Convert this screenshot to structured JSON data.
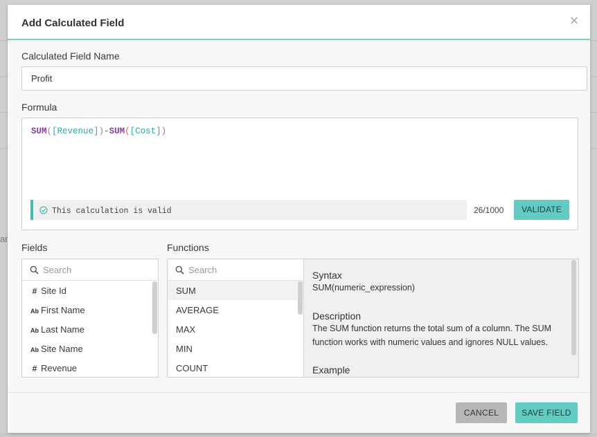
{
  "background": {
    "left_fragment": "ar"
  },
  "modal": {
    "title": "Add Calculated Field",
    "close_icon": "close-icon",
    "accent_color": "#62ccc2"
  },
  "name_field": {
    "label": "Calculated Field Name",
    "value": "Profit"
  },
  "formula": {
    "label": "Formula",
    "tokens": {
      "fn1": "SUM",
      "open1": "(",
      "field1": "[Revenue]",
      "close1": ")",
      "op": "-",
      "fn2": "SUM",
      "open2": "(",
      "field2": "[Cost]",
      "close2": ")"
    },
    "status_text": "This calculation is valid",
    "status_icon": "check-circle-icon",
    "counter": "26/1000",
    "validate_label": "VALIDATE"
  },
  "fields": {
    "label": "Fields",
    "search_placeholder": "Search",
    "items": [
      {
        "type": "#",
        "name": "Site Id"
      },
      {
        "type": "Ab",
        "name": "First Name"
      },
      {
        "type": "Ab",
        "name": "Last Name"
      },
      {
        "type": "Ab",
        "name": "Site Name"
      },
      {
        "type": "#",
        "name": "Revenue"
      }
    ]
  },
  "functions": {
    "label": "Functions",
    "search_placeholder": "Search",
    "items": [
      "SUM",
      "AVERAGE",
      "MAX",
      "MIN",
      "COUNT"
    ],
    "selected": "SUM"
  },
  "description": {
    "syntax_heading": "Syntax",
    "syntax": "SUM(numeric_expression)",
    "description_heading": "Description",
    "description": "The SUM function returns the total sum of a column. The SUM function works with numeric values and ignores NULL values.",
    "example_heading": "Example"
  },
  "footer": {
    "cancel_label": "CANCEL",
    "save_label": "SAVE FIELD"
  }
}
